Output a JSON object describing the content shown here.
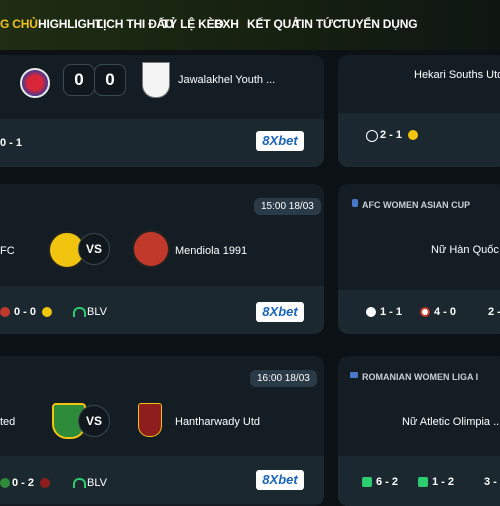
{
  "nav": {
    "items": [
      "G CHỦ",
      "HIGHLIGHT",
      "LỊCH THI ĐẤU",
      "TỶ LỆ KÈO",
      "BXH",
      "KẾT QUẢ",
      "TIN TỨC",
      "TUYỂN DỤNG"
    ]
  },
  "match1": {
    "home_score": "0",
    "colon": ":",
    "away_score": "0",
    "away_team": "Jawalakhel Youth ...",
    "odds": "0 - 1",
    "sponsor": "8Xbet"
  },
  "match2": {
    "time": "15:00 18/03",
    "home_team": "FC",
    "vs": "VS",
    "away_team": "Mendiola 1991",
    "odds": "0 - 0",
    "blv": "BLV",
    "sponsor": "8Xbet"
  },
  "match3": {
    "time": "16:00 18/03",
    "home_team": "ted",
    "vs": "VS",
    "away_team": "Hantharwady Utd",
    "odds": "0 - 2",
    "blv": "BLV",
    "sponsor": "8Xbet"
  },
  "right1": {
    "team": "Hekari Souths Utd",
    "odds": "2 - 1"
  },
  "right2": {
    "league": "AFC WOMEN ASIAN CUP",
    "team": "Nữ Hàn Quốc",
    "odds": [
      "1 - 1",
      "4 - 0",
      "2 -"
    ]
  },
  "right3": {
    "league": "ROMANIAN WOMEN LIGA I",
    "team": "Nữ Atletic Olimpia ...",
    "odds": [
      "6 - 2",
      "1 - 2",
      "3 -"
    ]
  }
}
